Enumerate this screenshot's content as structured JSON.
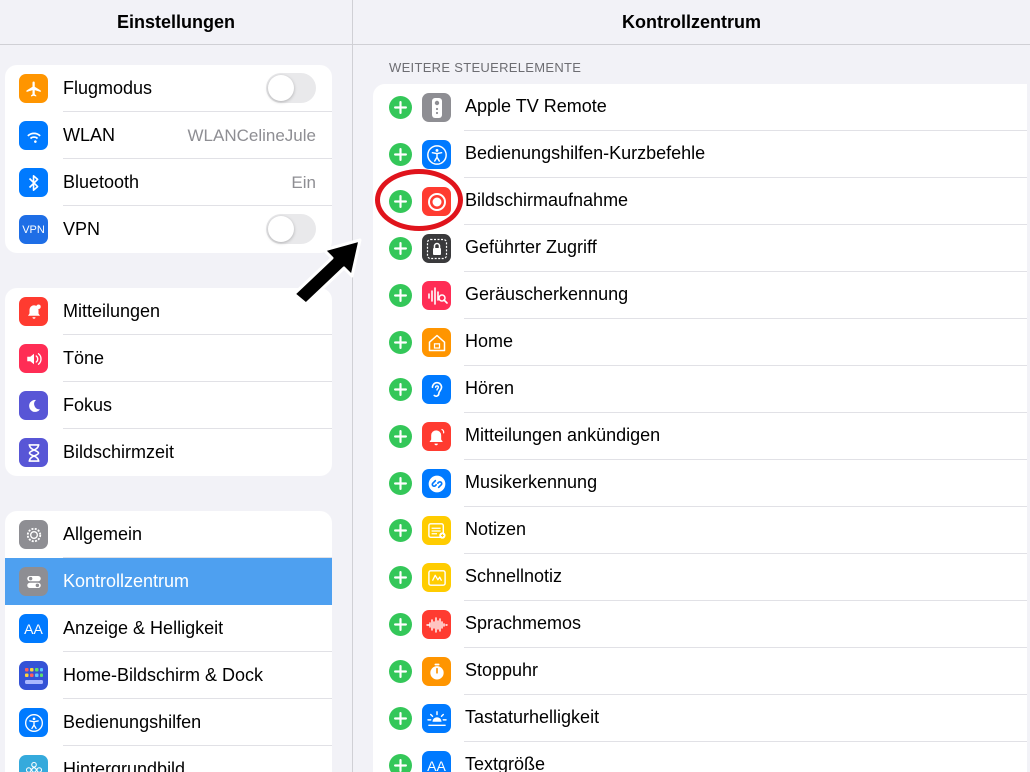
{
  "left": {
    "title": "Einstellungen",
    "groups": [
      {
        "items": [
          {
            "label": "Flugmodus",
            "icon": "airplane-icon",
            "color": "#ff9500",
            "control": "toggle",
            "toggle_on": false
          },
          {
            "label": "WLAN",
            "icon": "wifi-icon",
            "color": "#007aff",
            "value": "WLANCelineJule"
          },
          {
            "label": "Bluetooth",
            "icon": "bluetooth-icon",
            "color": "#007aff",
            "value": "Ein"
          },
          {
            "label": "VPN",
            "icon": "vpn-icon",
            "color": "#1e6ee6",
            "icon_text": "VPN",
            "control": "toggle",
            "toggle_on": false
          }
        ]
      },
      {
        "items": [
          {
            "label": "Mitteilungen",
            "icon": "notifications-icon",
            "color": "#ff3b30"
          },
          {
            "label": "Töne",
            "icon": "speaker-icon",
            "color": "#ff2d55"
          },
          {
            "label": "Fokus",
            "icon": "moon-icon",
            "color": "#5856d6"
          },
          {
            "label": "Bildschirmzeit",
            "icon": "hourglass-icon",
            "color": "#5856d6"
          }
        ]
      },
      {
        "items": [
          {
            "label": "Allgemein",
            "icon": "gear-icon",
            "color": "#8e8e93"
          },
          {
            "label": "Kontrollzentrum",
            "icon": "switches-icon",
            "color": "#8e8e93",
            "selected": true
          },
          {
            "label": "Anzeige & Helligkeit",
            "icon": "display-icon",
            "color": "#007aff",
            "icon_text": "AA"
          },
          {
            "label": "Home-Bildschirm & Dock",
            "icon": "home-screen-icon",
            "color": "#3452d6"
          },
          {
            "label": "Bedienungshilfen",
            "icon": "accessibility-icon",
            "color": "#007aff"
          },
          {
            "label": "Hintergrundbild",
            "icon": "wallpaper-icon",
            "color": "#35aadc"
          }
        ]
      }
    ]
  },
  "right": {
    "title": "Kontrollzentrum",
    "section_header": "WEITERE STEUERELEMENTE",
    "controls": [
      {
        "label": "Apple TV Remote",
        "icon": "remote-icon",
        "color": "#8e8e93"
      },
      {
        "label": "Bedienungshilfen-Kurzbefehle",
        "icon": "accessibility-icon",
        "color": "#007aff"
      },
      {
        "label": "Bildschirmaufnahme",
        "icon": "screen-record-icon",
        "color": "#ff3b30",
        "highlighted": true
      },
      {
        "label": "Geführter Zugriff",
        "icon": "lock-icon",
        "color": "#3a3a3c"
      },
      {
        "label": "Geräuscherkennung",
        "icon": "sound-recognition-icon",
        "color": "#ff2d55"
      },
      {
        "label": "Home",
        "icon": "house-icon",
        "color": "#ff9500"
      },
      {
        "label": "Hören",
        "icon": "ear-icon",
        "color": "#007aff"
      },
      {
        "label": "Mitteilungen ankündigen",
        "icon": "announce-icon",
        "color": "#ff3b30"
      },
      {
        "label": "Musikerkennung",
        "icon": "shazam-icon",
        "color": "#007aff"
      },
      {
        "label": "Notizen",
        "icon": "notes-icon",
        "color": "#ffcc00"
      },
      {
        "label": "Schnellnotiz",
        "icon": "quick-note-icon",
        "color": "#ffcc00"
      },
      {
        "label": "Sprachmemos",
        "icon": "voice-memo-icon",
        "color": "#ff3b30"
      },
      {
        "label": "Stoppuhr",
        "icon": "stopwatch-icon",
        "color": "#ff9500"
      },
      {
        "label": "Tastaturhelligkeit",
        "icon": "keyboard-brightness-icon",
        "color": "#007aff"
      },
      {
        "label": "Textgröße",
        "icon": "text-size-icon",
        "color": "#007aff",
        "icon_text": "AA"
      }
    ]
  },
  "colors": {
    "accent": "#4ea0f0",
    "add_green": "#34c759",
    "annotation_red": "#e0141c"
  }
}
